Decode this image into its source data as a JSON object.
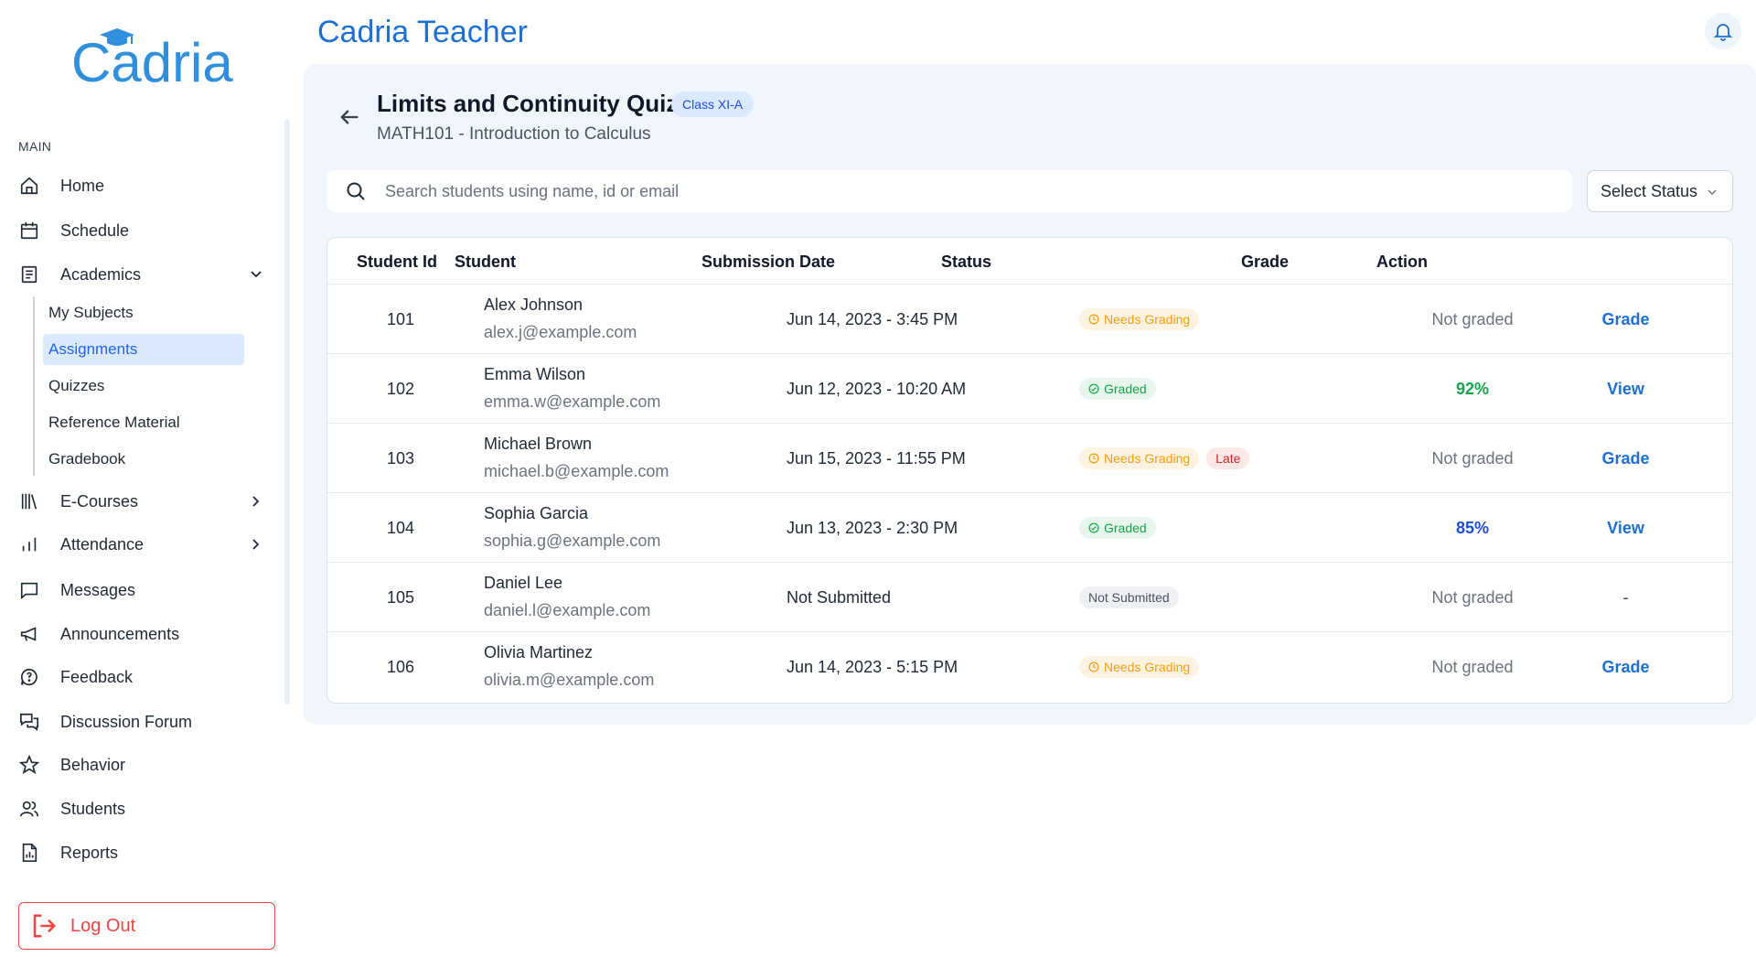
{
  "app": {
    "logo_text": "Cadria",
    "title": "Cadria Teacher"
  },
  "sidebar": {
    "section_label": "MAIN",
    "items": [
      {
        "label": "Home",
        "icon": "home-icon"
      },
      {
        "label": "Schedule",
        "icon": "calendar-icon"
      },
      {
        "label": "Academics",
        "icon": "document-icon",
        "expanded": true
      },
      {
        "label": "E-Courses",
        "icon": "library-icon"
      },
      {
        "label": "Attendance",
        "icon": "bar-chart-icon"
      },
      {
        "label": "Messages",
        "icon": "message-icon"
      },
      {
        "label": "Announcements",
        "icon": "megaphone-icon"
      },
      {
        "label": "Feedback",
        "icon": "feedback-icon"
      },
      {
        "label": "Discussion Forum",
        "icon": "forum-icon"
      },
      {
        "label": "Behavior",
        "icon": "star-icon"
      },
      {
        "label": "Students",
        "icon": "users-icon"
      },
      {
        "label": "Reports",
        "icon": "report-icon"
      }
    ],
    "academics_sub": [
      {
        "label": "My Subjects"
      },
      {
        "label": "Assignments",
        "active": true
      },
      {
        "label": "Quizzes"
      },
      {
        "label": "Reference Material"
      },
      {
        "label": "Gradebook"
      }
    ],
    "logout_label": "Log Out"
  },
  "quiz": {
    "title": "Limits and Continuity Quiz",
    "class_badge": "Class XI-A",
    "subtitle": "MATH101 - Introduction to Calculus"
  },
  "search": {
    "placeholder": "Search students using name, id or email",
    "value": ""
  },
  "status_filter": {
    "selected": "Select Status"
  },
  "table": {
    "headers": {
      "id": "Student Id",
      "student": "Student",
      "date": "Submission Date",
      "status": "Status",
      "grade": "Grade",
      "action": "Action"
    },
    "rows": [
      {
        "id": "101",
        "name": "Alex Johnson",
        "email": "alex.j@example.com",
        "date": "Jun 14, 2023 - 3:45 PM",
        "status": "Needs Grading",
        "late": "",
        "grade": "Not graded",
        "action": "Grade"
      },
      {
        "id": "102",
        "name": "Emma Wilson",
        "email": "emma.w@example.com",
        "date": "Jun 12, 2023 - 10:20 AM",
        "status": "Graded",
        "late": "",
        "grade": "92%",
        "action": "View"
      },
      {
        "id": "103",
        "name": "Michael Brown",
        "email": "michael.b@example.com",
        "date": "Jun 15, 2023 - 11:55 PM",
        "status": "Needs Grading",
        "late": "Late",
        "grade": "Not graded",
        "action": "Grade"
      },
      {
        "id": "104",
        "name": "Sophia Garcia",
        "email": "sophia.g@example.com",
        "date": "Jun 13, 2023 - 2:30 PM",
        "status": "Graded",
        "late": "",
        "grade": "85%",
        "action": "View"
      },
      {
        "id": "105",
        "name": "Daniel Lee",
        "email": "daniel.l@example.com",
        "date": "Not Submitted",
        "status": "Not Submitted",
        "late": "",
        "grade": "Not graded",
        "action": "-"
      },
      {
        "id": "106",
        "name": "Olivia Martinez",
        "email": "olivia.m@example.com",
        "date": "Jun 14, 2023 - 5:15 PM",
        "status": "Needs Grading",
        "late": "",
        "grade": "Not graded",
        "action": "Grade"
      }
    ]
  },
  "colors": {
    "brand": "#1d6fd1",
    "needs_grading": "#f59e0b",
    "graded": "#16a34a",
    "late": "#dc2626",
    "logout": "#ef4444"
  }
}
